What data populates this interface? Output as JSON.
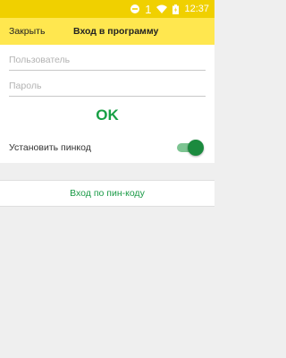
{
  "status_bar": {
    "time": "12:37",
    "notification_count": "1",
    "icons": [
      "do-not-disturb-icon",
      "wifi-icon",
      "battery-icon"
    ]
  },
  "toolbar": {
    "close_label": "Закрыть",
    "title": "Вход в программу"
  },
  "form": {
    "username_placeholder": "Пользователь",
    "username_value": "",
    "password_placeholder": "Пароль",
    "password_value": "",
    "ok_label": "OK",
    "pin_setting_label": "Установить пинкод",
    "pin_setting_enabled": true
  },
  "pin_login": {
    "label": "Вход по пин-коду"
  },
  "colors": {
    "status_bar": "#f0d000",
    "toolbar": "#ffe74f",
    "accent_green": "#17a045",
    "background": "#efefef"
  }
}
